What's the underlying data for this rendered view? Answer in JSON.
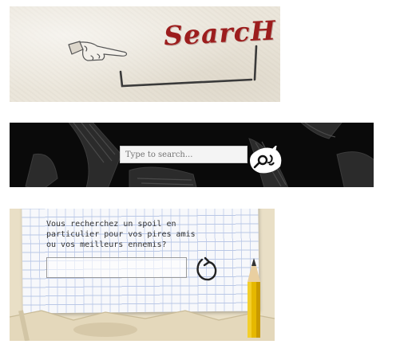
{
  "panel1": {
    "title": "SearcH",
    "icons": [
      "pointing-hand-icon",
      "bracket-underline-icon"
    ],
    "colors": {
      "title": "#9c1d1d",
      "paper": "#ebe6db"
    }
  },
  "panel2": {
    "search": {
      "placeholder": "Type to search..."
    },
    "icons": [
      "scribble-background",
      "search-button-icon"
    ],
    "colors": {
      "background": "#0a0a0a",
      "field": "#f4f4f4"
    }
  },
  "panel3": {
    "question_line1": "Vous recherchez un spoil en",
    "question_line2": "particulier pour vos pires amis",
    "question_line3": "ou vos meilleurs ennemis?",
    "input": {
      "value": "",
      "placeholder": ""
    },
    "icons": [
      "refresh-arrow-icon",
      "pencil-icon"
    ],
    "colors": {
      "pencil": "#e6b800",
      "paper_lines": "#b9c7e6"
    }
  }
}
